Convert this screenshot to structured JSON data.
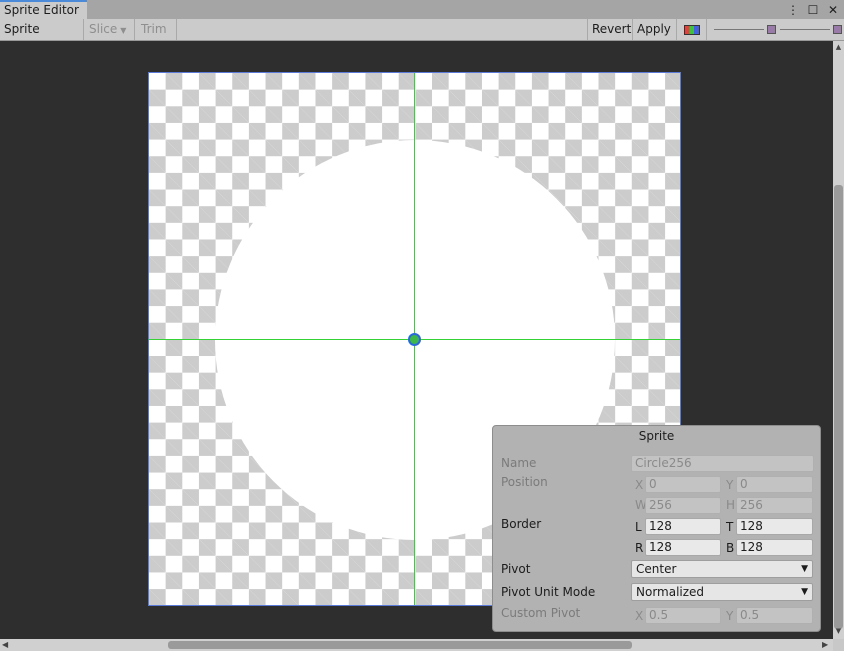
{
  "tab": {
    "title": "Sprite Editor"
  },
  "window_icons": {
    "menu": "⋮",
    "maximize": "☐",
    "close": "✕"
  },
  "toolbar": {
    "mode_label": "Sprite Editor",
    "slice_label": "Slice",
    "trim_label": "Trim",
    "revert_label": "Revert",
    "apply_label": "Apply"
  },
  "sprite_panel": {
    "title": "Sprite",
    "name_label": "Name",
    "name_value": "Circle256",
    "position_label": "Position",
    "x_label": "X",
    "x_value": "0",
    "y_label": "Y",
    "y_value": "0",
    "w_label": "W",
    "w_value": "256",
    "h_label": "H",
    "h_value": "256",
    "border_label": "Border",
    "l_label": "L",
    "l_value": "128",
    "t_label": "T",
    "t_value": "128",
    "r_label": "R",
    "r_value": "128",
    "b_label": "B",
    "b_value": "128",
    "pivot_label": "Pivot",
    "pivot_value": "Center",
    "pivot_unit_label": "Pivot Unit Mode",
    "pivot_unit_value": "Normalized",
    "custom_pivot_label": "Custom Pivot",
    "cpx_label": "X",
    "cpx_value": "0.5",
    "cpy_label": "Y",
    "cpy_value": "0.5"
  },
  "colors": {
    "accent": "#4a8ad8",
    "guide": "#34d234",
    "sprite_border": "#5b79d6"
  }
}
